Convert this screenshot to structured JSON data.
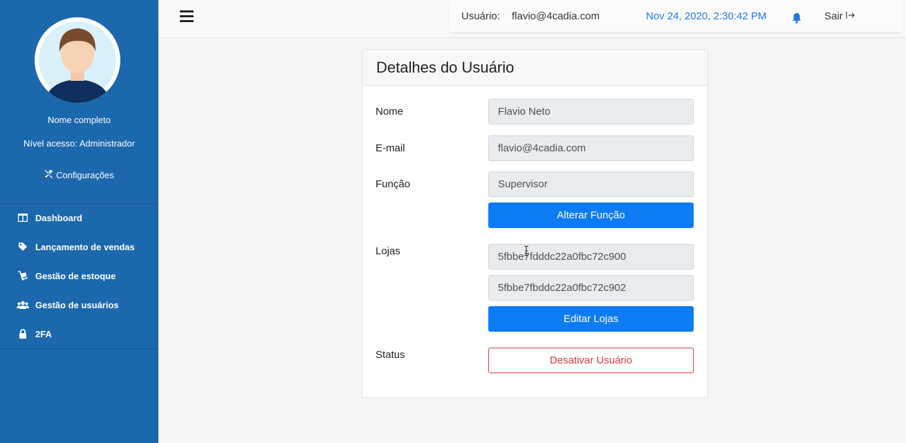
{
  "sidebar": {
    "profile_name": "Nome completo",
    "access_level": "Nível acesso: Administrador",
    "settings_label": "Configurações",
    "items": [
      {
        "label": "Dashboard",
        "icon": "table-icon"
      },
      {
        "label": "Lançamento de vendas",
        "icon": "tag-icon"
      },
      {
        "label": "Gestão de estoque",
        "icon": "dolly-icon"
      },
      {
        "label": "Gestão de usuários",
        "icon": "users-icon"
      },
      {
        "label": "2FA",
        "icon": "lock-icon"
      }
    ]
  },
  "header": {
    "user_label": "Usuário:",
    "user_email": "flavio@4cadia.com",
    "datetime": "Nov 24, 2020, 2:30:42 PM",
    "logout_label": "Sair"
  },
  "card": {
    "title": "Detalhes do Usuário",
    "name_label": "Nome",
    "name_value": "Flavio Neto",
    "email_label": "E-mail",
    "email_value": "flavio@4cadia.com",
    "role_label": "Função",
    "role_value": "Supervisor",
    "change_role_button": "Alterar Função",
    "stores_label": "Lojas",
    "stores": [
      "5fbbe7fdddc22a0fbc72c900",
      "5fbbe7fbddc22a0fbc72c902"
    ],
    "edit_stores_button": "Editar Lojas",
    "status_label": "Status",
    "deactivate_button": "Desativar Usuário"
  },
  "colors": {
    "sidebar_bg": "#1b68ad",
    "primary": "#0d7cf2",
    "danger": "#dc3545",
    "datetime": "#1a7bd8"
  }
}
